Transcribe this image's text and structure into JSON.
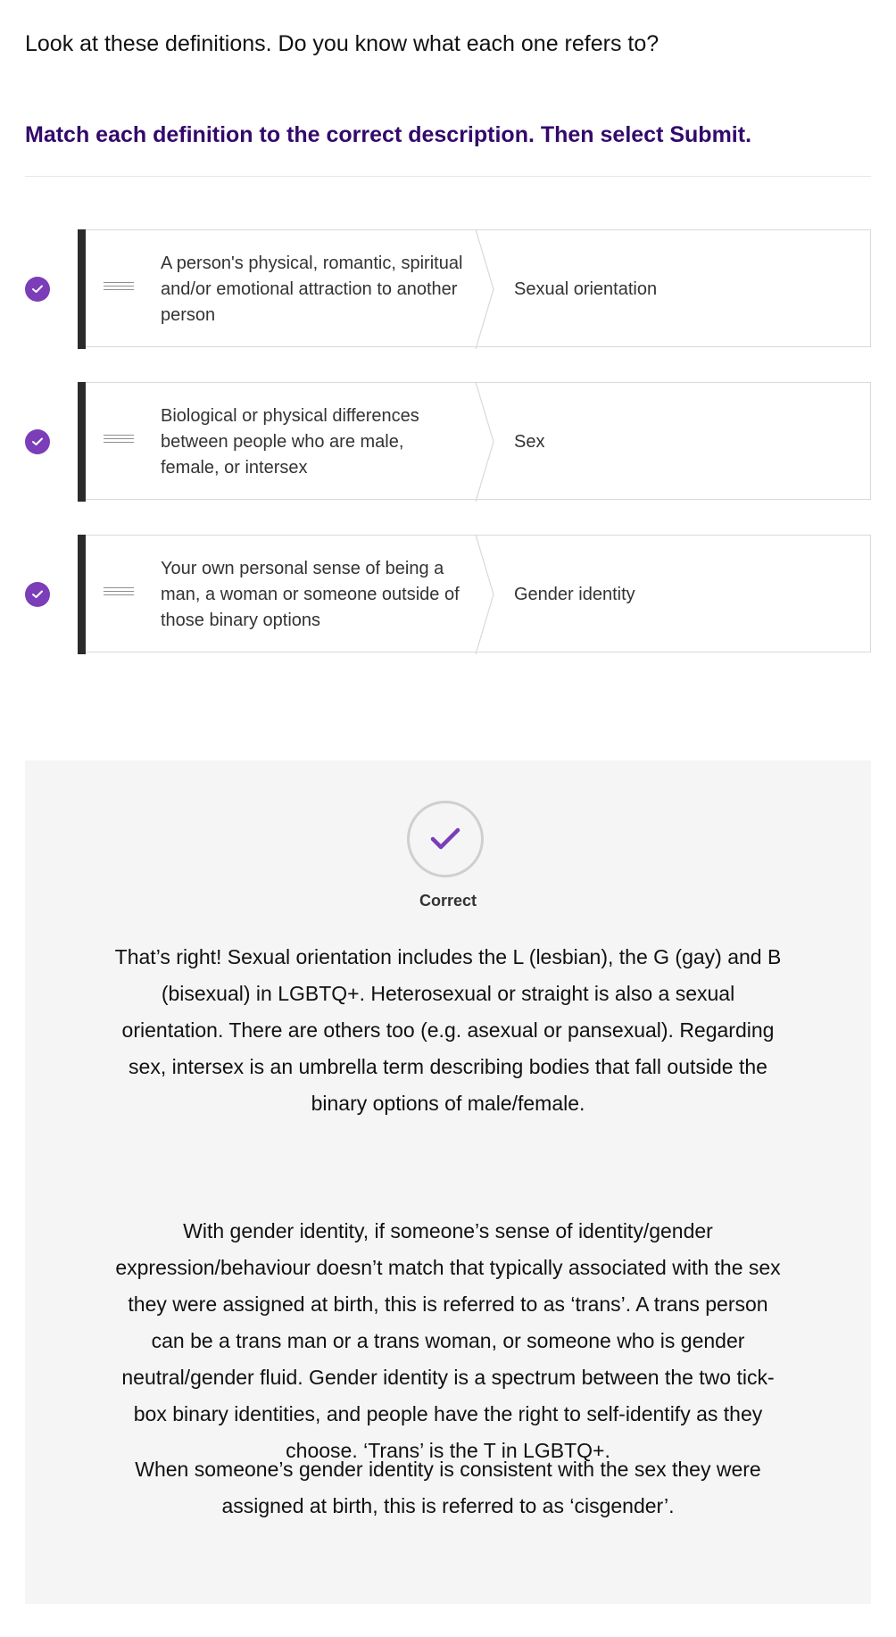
{
  "intro": "Look at these definitions. Do you know what each one refers to?",
  "instruction": "Match each definition to the correct description. Then select Submit.",
  "colors": {
    "accent": "#7b3db8",
    "instruction": "#33096b",
    "bar": "#2b2b2b",
    "feedback_bg": "#f5f5f5"
  },
  "matches": [
    {
      "status": "correct",
      "definition": "A person's physical, romantic, spiritual and/or emotional attraction to another person",
      "answer": "Sexual orientation"
    },
    {
      "status": "correct",
      "definition": "Biological or physical differences between people who are male, female, or intersex",
      "answer": "Sex"
    },
    {
      "status": "correct",
      "definition": "Your own personal sense of being a man, a woman or someone outside of those binary options",
      "answer": "Gender identity"
    }
  ],
  "feedback": {
    "icon": "checkmark-icon",
    "label": "Correct",
    "paragraphs": [
      "That’s right! Sexual orientation includes the L (lesbian), the G (gay) and B (bisexual) in LGBTQ+.  Heterosexual or straight is also a sexual orientation. There are others too (e.g. asexual or pansexual). Regarding sex, intersex is an umbrella term describing bodies that fall outside the binary options of male/female.",
      "With gender identity, if someone’s sense of identity/gender expression/behaviour doesn’t match that typically associated with the sex they were assigned at birth, this is referred to as ‘trans’.  A trans person can be a trans man or a trans woman, or someone who is gender neutral/gender fluid. Gender identity is a spectrum between the two tick-box binary identities, and people have the right to self-identify as they choose. ‘Trans’ is the T in LGBTQ+.",
      "When someone’s gender identity is consistent with the sex they were assigned at birth, this is referred to as ‘cisgender’."
    ]
  }
}
